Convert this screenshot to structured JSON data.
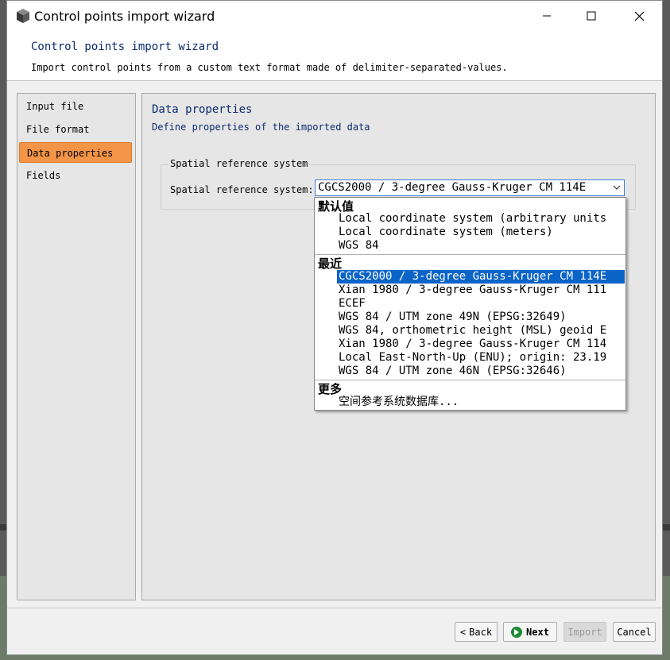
{
  "window": {
    "title": "Control points import wizard",
    "controls": {
      "minimize": "—",
      "maximize": "☐",
      "close": "✕"
    }
  },
  "header": {
    "title": "Control points import wizard",
    "subtitle": "Import control points from a custom text format made of delimiter-separated-values."
  },
  "sidebar": {
    "items": [
      {
        "label": "Input file",
        "active": false
      },
      {
        "label": "File format",
        "active": false
      },
      {
        "label": "Data properties",
        "active": true
      },
      {
        "label": "Fields",
        "active": false
      }
    ]
  },
  "content": {
    "title": "Data properties",
    "subtitle": "Define properties of the imported data",
    "group_title": "Spatial reference system",
    "srs_label": "Spatial reference system:",
    "srs_value": "CGCS2000 / 3-degree Gauss-Kruger CM 114E"
  },
  "dropdown": {
    "sections": [
      {
        "title": "默认值",
        "items": [
          "Local coordinate system (arbitrary units",
          "Local coordinate system (meters)",
          "WGS 84"
        ]
      },
      {
        "title": "最近",
        "items": [
          "CGCS2000 / 3-degree Gauss-Kruger CM 114E",
          "Xian 1980 / 3-degree Gauss-Kruger CM 111",
          "ECEF",
          "WGS 84 / UTM zone 49N (EPSG:32649)",
          "WGS 84, orthometric height (MSL) geoid E",
          "Xian 1980 / 3-degree Gauss-Kruger CM 114",
          "Local East-North-Up (ENU); origin: 23.19",
          "WGS 84 / UTM zone 46N (EPSG:32646)"
        ],
        "selected_index": 0
      },
      {
        "title": "更多",
        "items": [
          "空间参考系统数据库..."
        ]
      }
    ]
  },
  "buttons": {
    "back": "Back",
    "next": "Next",
    "import": "Import",
    "cancel": "Cancel"
  },
  "colors": {
    "accent_active": "#f49447",
    "selection": "#0a64c8",
    "title_blue": "#0b2a6f"
  }
}
